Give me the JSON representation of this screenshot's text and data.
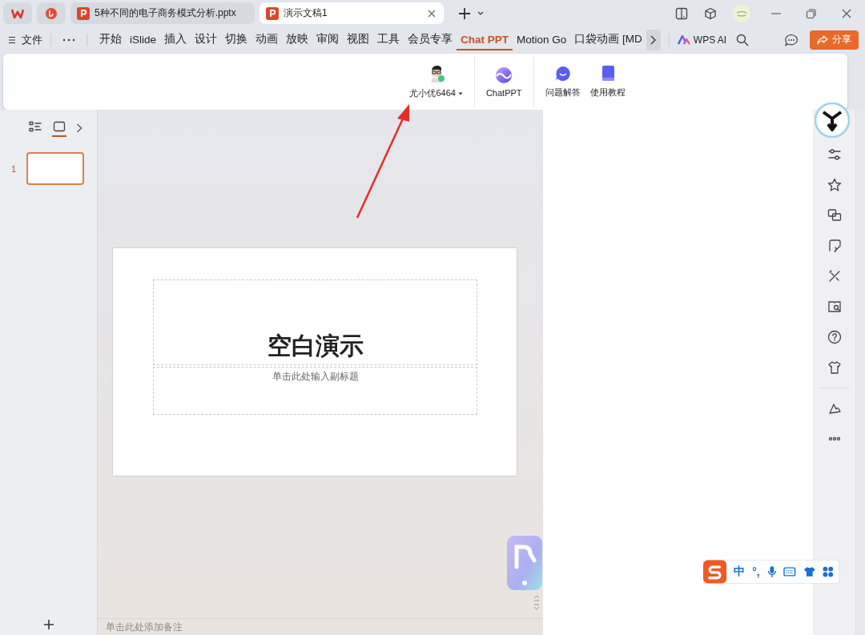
{
  "title_bar": {
    "tabs": [
      {
        "kind": "home",
        "selected": false
      },
      {
        "kind": "app",
        "selected": false
      },
      {
        "kind": "document",
        "title": "5种不同的电子商务模式分析.pptx",
        "selected": false
      },
      {
        "kind": "document",
        "title": "演示文稿1",
        "selected": true
      }
    ]
  },
  "menu": {
    "file_label": "文件",
    "items": [
      {
        "label": "开始",
        "selected": false
      },
      {
        "label": "iSlide",
        "selected": false
      },
      {
        "label": "插入",
        "selected": false
      },
      {
        "label": "设计",
        "selected": false
      },
      {
        "label": "切换",
        "selected": false
      },
      {
        "label": "动画",
        "selected": false
      },
      {
        "label": "放映",
        "selected": false
      },
      {
        "label": "审阅",
        "selected": false
      },
      {
        "label": "视图",
        "selected": false
      },
      {
        "label": "工具",
        "selected": false
      },
      {
        "label": "会员专享",
        "selected": false
      },
      {
        "label": "Chat PPT",
        "selected": true
      },
      {
        "label": "Motion Go",
        "selected": false
      },
      {
        "label": "口袋动画 [MD",
        "selected": false
      }
    ],
    "wps_ai": "WPS AI",
    "share": "分享"
  },
  "ribbon": {
    "user": "尤小优6464",
    "buttons": [
      {
        "kind": "chatppt",
        "label": "ChatPPT"
      },
      {
        "kind": "faq",
        "label": "问题解答"
      },
      {
        "kind": "tutorial",
        "label": "使用教程"
      }
    ]
  },
  "left_panel": {
    "views": [
      {
        "kind": "outline",
        "selected": false
      },
      {
        "kind": "slides",
        "selected": true
      }
    ],
    "slides": [
      {
        "number": "1",
        "selected": true
      }
    ]
  },
  "slide": {
    "title": "空白演示",
    "subtitle_placeholder": "单击此处输入副标题"
  },
  "notes": {
    "placeholder": "单击此处添加备注"
  },
  "ime": {
    "mode": "中",
    "punctuation": "°,"
  }
}
